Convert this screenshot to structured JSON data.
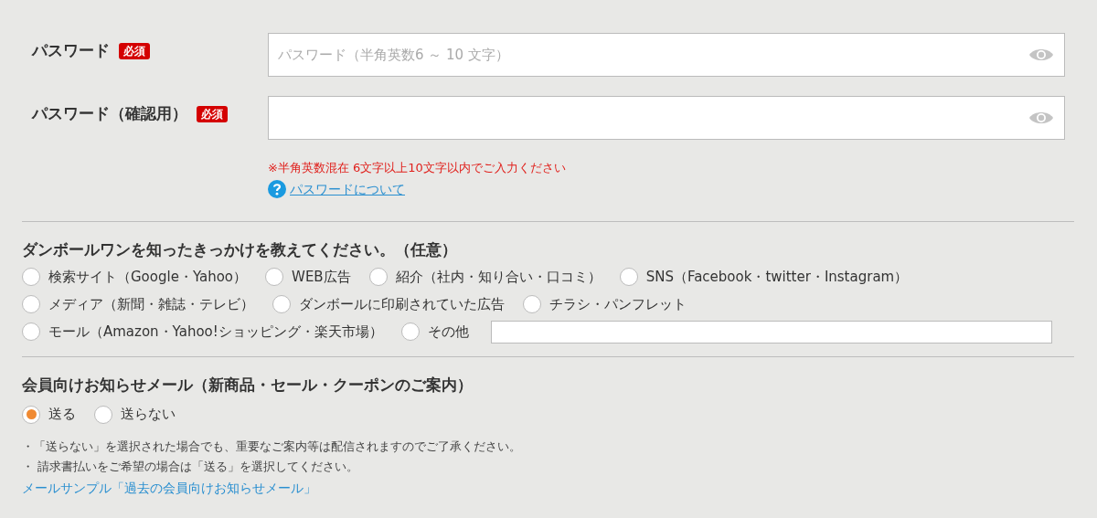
{
  "password_fields": [
    {
      "label": "パスワード",
      "badge": "必須",
      "placeholder": "パスワード（半角英数6 ～ 10 文字）"
    },
    {
      "label": "パスワード（確認用）",
      "badge": "必須"
    }
  ],
  "password_hint": "※半角英数混在 6文字以上10文字以内でご入力ください",
  "password_help_link": "パスワードについて",
  "referral": {
    "heading": "ダンボールワンを知ったきっかけを教えてください。（任意）",
    "option_rows": [
      [
        {
          "label": "検索サイト（Google・Yahoo）",
          "selected": false
        },
        {
          "label": "WEB広告",
          "selected": false
        },
        {
          "label": "紹介（社内・知り合い・口コミ）",
          "selected": false
        },
        {
          "label": "SNS（Facebook・twitter・Instagram）",
          "selected": false
        }
      ],
      [
        {
          "label": "メディア（新聞・雑誌・テレビ）",
          "selected": false
        },
        {
          "label": "ダンボールに印刷されていた広告",
          "selected": false
        },
        {
          "label": "チラシ・パンフレット",
          "selected": false
        }
      ],
      [
        {
          "label": "モール（Amazon・Yahoo!ショッピング・楽天市場）",
          "selected": false
        },
        {
          "label": "その他",
          "selected": false,
          "kind": "other"
        }
      ]
    ]
  },
  "newsletter": {
    "heading": "会員向けお知らせメール（新商品・セール・クーポンのご案内）",
    "options": [
      {
        "label": "送る",
        "selected": true
      },
      {
        "label": "送らない",
        "selected": false
      }
    ],
    "notes": [
      "・「送らない」を選択された場合でも、重要なご案内等は配信されますのでご了承ください。",
      "・ 請求書払いをご希望の場合は「送る」を選択してください。"
    ],
    "sample_link": "メールサンプル「過去の会員向けお知らせメール」"
  }
}
